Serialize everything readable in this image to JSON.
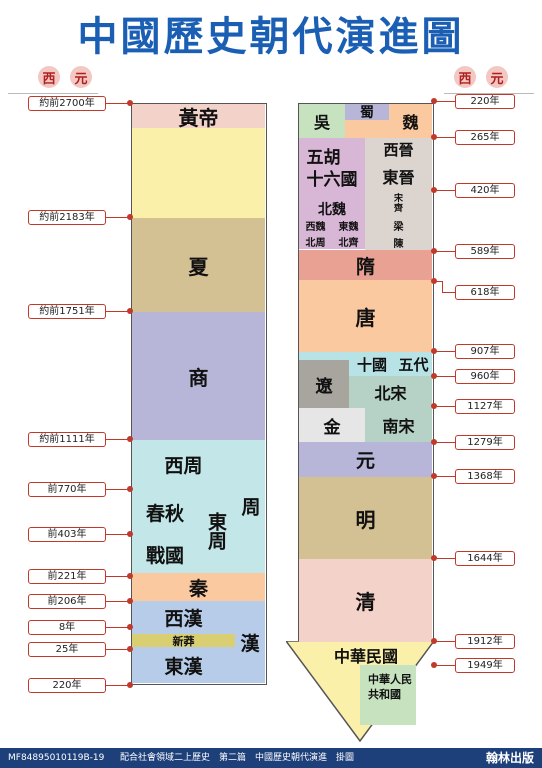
{
  "title": "中國歷史朝代演進圖",
  "xiyuan": {
    "left": [
      "西",
      "元"
    ],
    "right": [
      "西",
      "元"
    ]
  },
  "left_years": [
    "約前2700年",
    "約前2183年",
    "約前1751年",
    "約前1111年",
    "前770年",
    "前403年",
    "前221年",
    "前206年",
    "8年",
    "25年",
    "220年"
  ],
  "right_years": [
    "220年",
    "265年",
    "420年",
    "589年",
    "618年",
    "907年",
    "960年",
    "1127年",
    "1279年",
    "1368年",
    "1644年",
    "1912年",
    "1949年"
  ],
  "dynasties": {
    "huangdi": "黃帝",
    "xia": "夏",
    "shang": "商",
    "xizhou": "西周",
    "chunqiu": "春秋",
    "zhanguo": "戰國",
    "dongzhou": "東周",
    "zhou": "周",
    "qin": "秦",
    "xihan": "西漢",
    "xinmang": "新莽",
    "donghan": "東漢",
    "han": "漢",
    "wu": "吳",
    "shu": "蜀",
    "wei": "魏",
    "xijin": "西晉",
    "dongjin": "東晉",
    "wuhu": "五胡\n十六國",
    "beiwei": "北魏",
    "xiwei": "西魏",
    "dongwei": "東魏",
    "beizhou": "北周",
    "beiqi": "北齊",
    "song_s": "宋\n齊",
    "liang": "梁",
    "chen": "陳",
    "sui": "隋",
    "tang": "唐",
    "shiguo": "十國",
    "wudai": "五代",
    "liao": "遼",
    "beisong": "北宋",
    "jin": "金",
    "nansong": "南宋",
    "yuan": "元",
    "ming": "明",
    "qing": "清",
    "zhonghua": "中華民國",
    "prc": "中華人民\n共和國"
  },
  "footer": {
    "code": "MF848950101",
    "page": "19B-19",
    "text": "配合社會領域二上歷史　第二篇　中國歷史朝代演進　掛圖",
    "publisher": "翰林出版"
  },
  "colors": {
    "title": "#1a5fb4",
    "connector": "#c0392b",
    "footer_bg": "#1d3f7a"
  }
}
